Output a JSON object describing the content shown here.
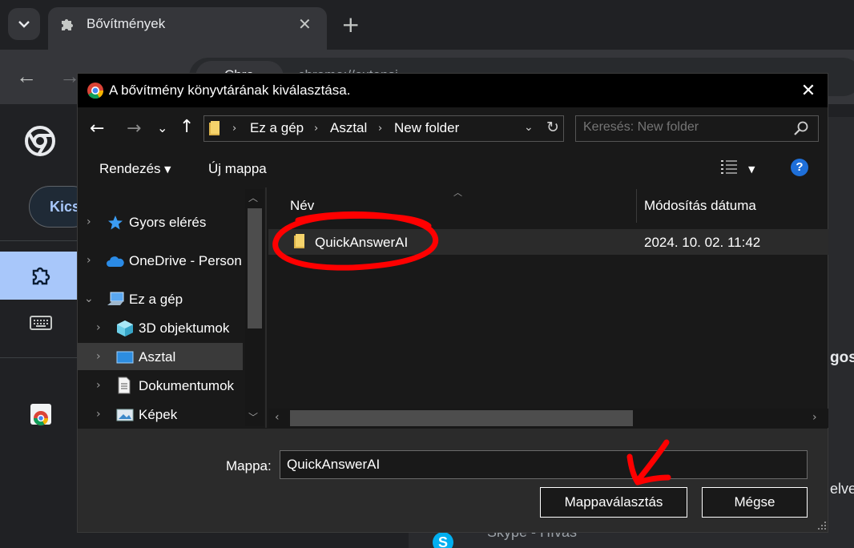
{
  "browser": {
    "tab_title": "Bővítmények",
    "chip_text": "Chro",
    "url_text": "chrome://extensi",
    "dev_button_text": "Kics",
    "right_fragment_1": "gos",
    "right_fragment_2": "elve",
    "skype_text": "Skype - Hívás",
    "icons": [
      "puzzle-icon",
      "close-icon",
      "plus-icon",
      "back-arrow-icon",
      "forward-arrow-icon",
      "chrome-logo-icon",
      "keyboard-icon",
      "skype-icon"
    ]
  },
  "dialog": {
    "title": "A bővítmény könyvtárának kiválasztása.",
    "breadcrumb": [
      "Ez a gép",
      "Asztal",
      "New folder"
    ],
    "search_placeholder": "Keresés: New folder",
    "commands": {
      "organize": "Rendezés",
      "new_folder": "Új mappa"
    },
    "nav_tree": [
      {
        "label": "Gyors elérés",
        "icon": "star-icon",
        "level": 0,
        "expanded": false
      },
      {
        "label": "OneDrive - Person",
        "icon": "cloud-icon",
        "level": 0,
        "expanded": false
      },
      {
        "label": "Ez a gép",
        "icon": "computer-icon",
        "level": 0,
        "expanded": true
      },
      {
        "label": "3D objektumok",
        "icon": "cube-icon",
        "level": 1,
        "expanded": false
      },
      {
        "label": "Asztal",
        "icon": "desktop-icon",
        "level": 1,
        "expanded": false,
        "selected": true
      },
      {
        "label": "Dokumentumok",
        "icon": "document-icon",
        "level": 1,
        "expanded": false
      },
      {
        "label": "Képek",
        "icon": "pictures-icon",
        "level": 1,
        "expanded": false
      }
    ],
    "columns": {
      "name": "Név",
      "date_modified": "Módosítás dátuma"
    },
    "rows": [
      {
        "name": "QuickAnswerAI",
        "date": "2024. 10. 02. 11:42"
      }
    ],
    "folder_label": "Mappa:",
    "folder_value": "QuickAnswerAI",
    "select_button": "Mappaválasztás",
    "cancel_button": "Mégse",
    "help_glyph": "?"
  },
  "colors": {
    "dialog_bg": "#191919",
    "titlebar": "#000000",
    "annotation_red": "#ff0000",
    "accent_blue": "#1e6fd9"
  }
}
